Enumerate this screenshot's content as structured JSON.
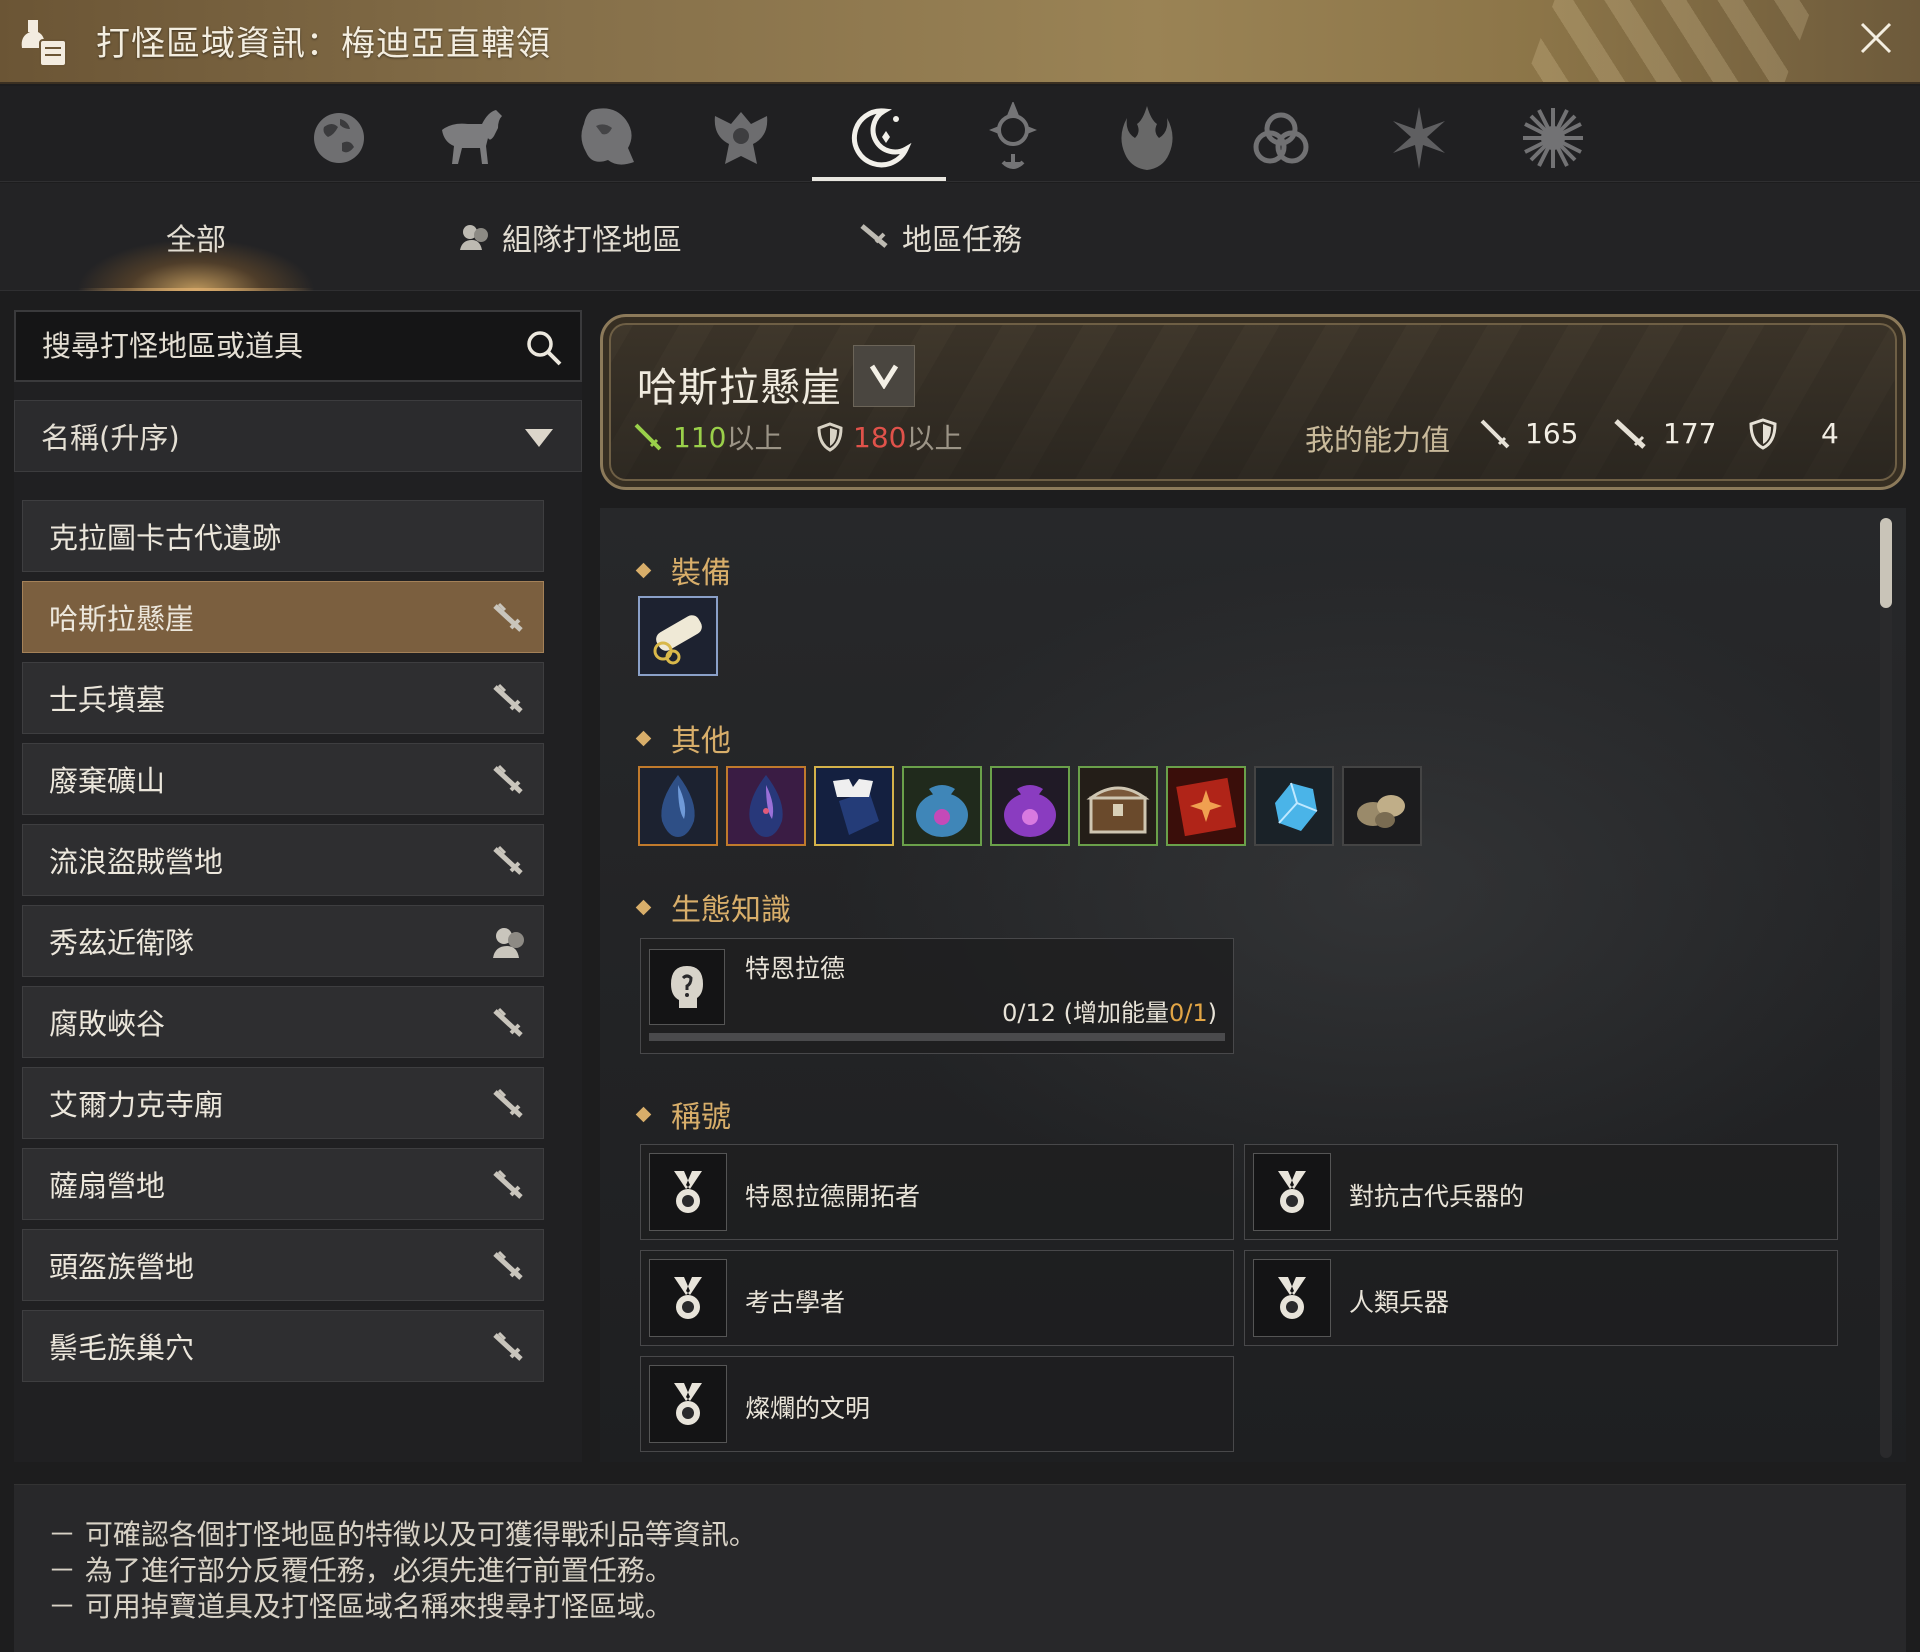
{
  "window": {
    "title": "打怪區域資訊：梅迪亞直轄領",
    "title_icon": "scroll-quill-icon",
    "close_icon": "close-icon"
  },
  "categories": [
    {
      "name": "globe-icon",
      "active": false
    },
    {
      "name": "horse-icon",
      "active": false
    },
    {
      "name": "lion-icon",
      "active": false
    },
    {
      "name": "winged-crest-icon",
      "active": false
    },
    {
      "name": "crescent-moon-icon",
      "active": true
    },
    {
      "name": "compass-sigil-icon",
      "active": false
    },
    {
      "name": "flame-crest-icon",
      "active": false
    },
    {
      "name": "triquetra-icon",
      "active": false
    },
    {
      "name": "star-burst-icon",
      "active": false
    },
    {
      "name": "sun-burst-icon",
      "active": false
    }
  ],
  "tabs": {
    "all": "全部",
    "party": "組隊打怪地區",
    "quest": "地區任務"
  },
  "search": {
    "placeholder": "搜尋打怪地區或道具"
  },
  "sort": {
    "selected": "名稱(升序)"
  },
  "zones": [
    {
      "label": "克拉圖卡古代遺跡",
      "icon": ""
    },
    {
      "label": "哈斯拉懸崖",
      "icon": "sword-icon"
    },
    {
      "label": "士兵墳墓",
      "icon": "sword-icon"
    },
    {
      "label": "廢棄礦山",
      "icon": "sword-icon"
    },
    {
      "label": "流浪盜賊營地",
      "icon": "sword-icon"
    },
    {
      "label": "秀茲近衛隊",
      "icon": "party-icon"
    },
    {
      "label": "腐敗峽谷",
      "icon": "sword-icon"
    },
    {
      "label": "艾爾力克寺廟",
      "icon": "sword-icon"
    },
    {
      "label": "薩扇營地",
      "icon": "sword-icon"
    },
    {
      "label": "頭盔族營地",
      "icon": "sword-icon"
    },
    {
      "label": "鬃毛族巢穴",
      "icon": "sword-icon"
    }
  ],
  "selected_zone": {
    "name": "哈斯拉懸崖",
    "ap_req": "110",
    "ap_suffix": "以上",
    "dp_req": "180",
    "dp_suffix": "以上",
    "my_stats_label": "我的能力值",
    "my_ap": "165",
    "my_aap": "177",
    "my_dp": "4",
    "colors": {
      "ap": "#9ad04a",
      "dp": "#e0524a"
    }
  },
  "sections": {
    "equipment": "裝備",
    "other": "其他",
    "lore": "生態知識",
    "titles": "稱號"
  },
  "equipment_items": [
    {
      "name": "scroll-item-icon",
      "border": "#8aa0c8"
    }
  ],
  "other_items": [
    {
      "name": "blue-crystal-icon",
      "border": "#c07a2c"
    },
    {
      "name": "purple-crystal-icon",
      "border": "#c07a2c"
    },
    {
      "name": "armor-stone-icon",
      "border": "#d4b24a"
    },
    {
      "name": "blue-pouch-icon",
      "border": "#6aa04a"
    },
    {
      "name": "purple-pouch-icon",
      "border": "#6aa04a"
    },
    {
      "name": "treasure-chest-icon",
      "border": "#6aa04a"
    },
    {
      "name": "red-book-icon",
      "border": "#6aa04a"
    },
    {
      "name": "blue-gem-icon",
      "border": "#444444"
    },
    {
      "name": "ore-icon",
      "border": "#444444"
    }
  ],
  "lore": {
    "name": "特恩拉德",
    "progress": "0/12 (增加能量",
    "energy": "0/1",
    "close_paren": ")",
    "fraction": 0
  },
  "titles": [
    "特恩拉德開拓者",
    "對抗古代兵器的",
    "考古學者",
    "人類兵器",
    "燦爛的文明"
  ],
  "footer": [
    "－ 可確認各個打怪地區的特徵以及可獲得戰利品等資訊。",
    "－ 為了進行部分反覆任務，必須先進行前置任務。",
    "－ 可用掉寶道具及打怪區域名稱來搜尋打怪區域。"
  ]
}
